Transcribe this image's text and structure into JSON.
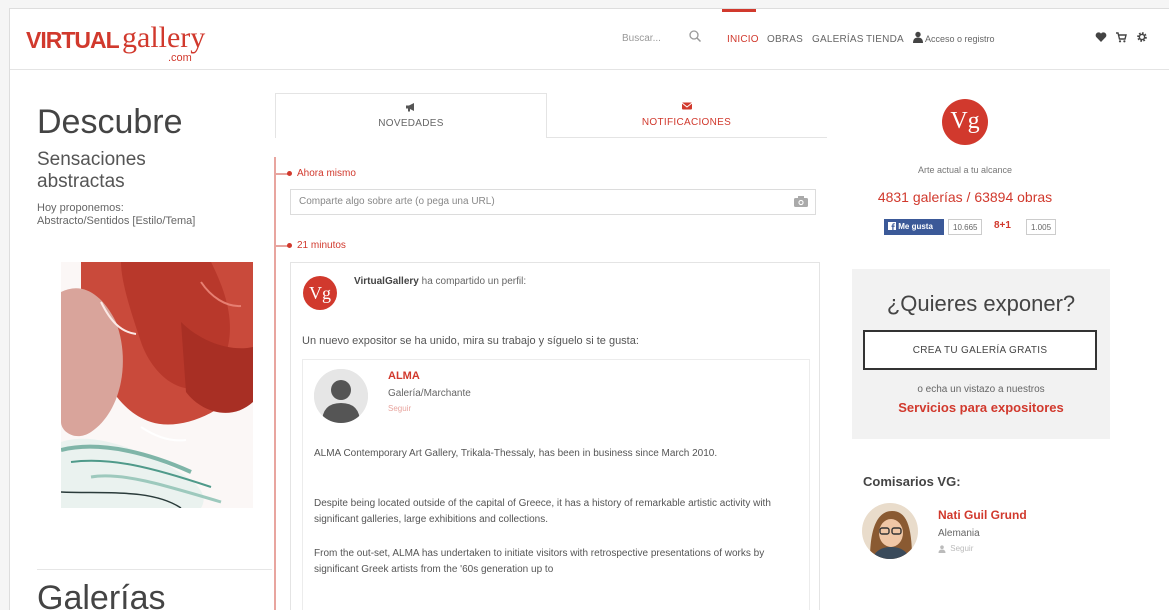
{
  "header": {
    "logo_virtual": "VIRTUAL",
    "logo_gallery": "gallery",
    "logo_com": ".com",
    "search_placeholder": "Buscar...",
    "nav": [
      "INICIO",
      "OBRAS",
      "GALERÍAS",
      "TIENDA"
    ],
    "login_label": "Acceso o registro"
  },
  "left": {
    "title": "Descubre",
    "subtitle": "Sensaciones abstractas",
    "proponemos_line1": "Hoy proponemos:",
    "proponemos_line2": "Abstracto/Sentidos [Estilo/Tema]",
    "section_title": "Galerías"
  },
  "tabs": {
    "novedades": "NOVEDADES",
    "notificaciones": "NOTIFICACIONES"
  },
  "feed": {
    "now_label": "Ahora mismo",
    "share_placeholder": "Comparte algo sobre arte (o pega una URL)",
    "time_label": "21 minutos",
    "post_author": "VirtualGallery",
    "post_action": " ha compartido un perfil:",
    "avatar_text": "Vg",
    "post_text": "Un nuevo expositor se ha unido, mira su trabajo y síguelo si te gusta:",
    "profile": {
      "name": "ALMA",
      "type": "Galería/Marchante",
      "follow": "Seguir",
      "para1": "ALMA Contemporary Art Gallery, Trikala-Thessaly, has been in business since March 2010.",
      "para2": "Despite being located outside of the capital of Greece, it has a history of remarkable artistic activity with significant galleries, large exhibitions and collections.",
      "para3": "From the out-set, ALMA has undertaken to initiate visitors with retrospective presentations of works by significant Greek artists from the '60s generation up to"
    }
  },
  "right": {
    "logo_text": "Vg",
    "tagline": "Arte actual a tu alcance",
    "stats": "4831 galerías / 63894 obras",
    "fb_label": "Me gusta",
    "fb_count": "10.665",
    "gplus_label": "8+1",
    "gplus_count": "1.005",
    "expose_title": "¿Quieres exponer?",
    "create_button": "CREA TU GALERÍA GRATIS",
    "echa": "o echa un vistazo a nuestros",
    "servicios": "Servicios para expositores",
    "comisarios_title": "Comisarios VG:",
    "curator_name": "Nati Guil Grund",
    "curator_country": "Alemania",
    "curator_follow": "Seguir"
  },
  "colors": {
    "accent": "#d1392d",
    "facebook": "#3b5998"
  }
}
